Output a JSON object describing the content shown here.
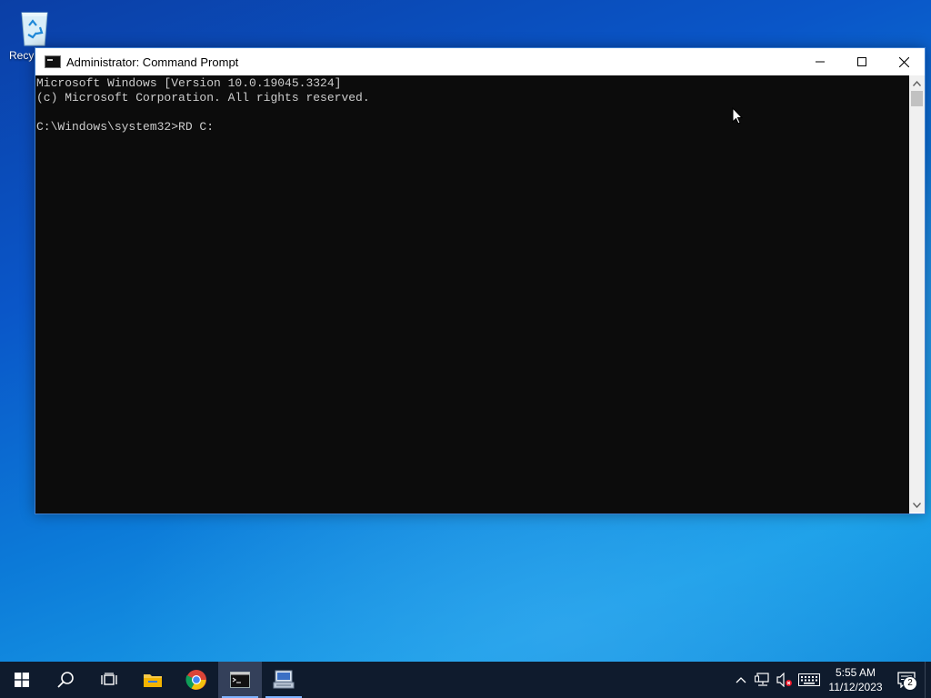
{
  "desktop": {
    "recycle_bin_label": "Recycle Bin"
  },
  "window": {
    "title": "Administrator: Command Prompt",
    "console_lines": [
      "Microsoft Windows [Version 10.0.19045.3324]",
      "(c) Microsoft Corporation. All rights reserved.",
      "",
      "C:\\Windows\\system32>RD C:"
    ],
    "controls": [
      "minimize-icon",
      "maximize-icon",
      "close-icon"
    ]
  },
  "taskbar": {
    "apps": [
      "start-icon",
      "search-icon",
      "task-view-icon",
      "file-explorer-icon",
      "chrome-icon",
      "command-prompt-icon",
      "network-app-icon"
    ],
    "tray_icons": [
      "chevron-up-icon",
      "network-icon",
      "volume-muted-icon",
      "keyboard-icon"
    ],
    "time": "5:55 AM",
    "date": "11/12/2023",
    "notification_count": "2"
  },
  "colors": {
    "console_bg": "#0c0c0c",
    "console_text": "#cccccc",
    "taskbar_bg": "#0f1b2d"
  }
}
